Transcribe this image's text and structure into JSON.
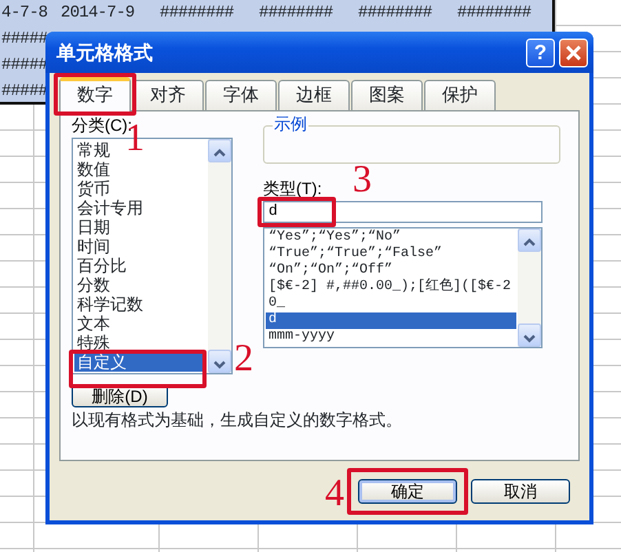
{
  "sheet": {
    "rows": [
      {
        "selected": true,
        "cells": [
          "4-7-8",
          "2014-7-9",
          "########",
          "########",
          "########",
          "########"
        ]
      },
      {
        "selected": true,
        "cells": [
          "#####"
        ]
      },
      {
        "selected": true,
        "cells": [
          "#####"
        ]
      },
      {
        "selected": true,
        "cells": [
          "#####"
        ]
      }
    ]
  },
  "dialog": {
    "title": "单元格格式",
    "help": "?",
    "tabs": [
      {
        "label": "数字",
        "selected": true,
        "annotation": "1"
      },
      {
        "label": "对齐",
        "selected": false
      },
      {
        "label": "字体",
        "selected": false
      },
      {
        "label": "边框",
        "selected": false
      },
      {
        "label": "图案",
        "selected": false
      },
      {
        "label": "保护",
        "selected": false
      }
    ],
    "category_label": "分类(C):",
    "categories": [
      {
        "label": "常规",
        "selected": false
      },
      {
        "label": "数值",
        "selected": false
      },
      {
        "label": "货币",
        "selected": false
      },
      {
        "label": "会计专用",
        "selected": false
      },
      {
        "label": "日期",
        "selected": false
      },
      {
        "label": "时间",
        "selected": false
      },
      {
        "label": "百分比",
        "selected": false
      },
      {
        "label": "分数",
        "selected": false
      },
      {
        "label": "科学记数",
        "selected": false
      },
      {
        "label": "文本",
        "selected": false
      },
      {
        "label": "特殊",
        "selected": false
      },
      {
        "label": "自定义",
        "selected": true,
        "annotation": "2"
      }
    ],
    "delete_button": "删除(D)",
    "sample_label": "示例",
    "type_label": "类型(T):",
    "type_input": {
      "value": "d",
      "annotation": "3"
    },
    "types": [
      {
        "label": "“Yes”;“Yes”;“No”",
        "selected": false
      },
      {
        "label": "“True”;“True”;“False”",
        "selected": false
      },
      {
        "label": "“On”;“On”;“Off”",
        "selected": false
      },
      {
        "label": "[$€-2] #,##0.00_);[红色]([$€-2",
        "selected": false
      },
      {
        "label": "0_",
        "selected": false
      },
      {
        "label": "d",
        "selected": true
      },
      {
        "label": "mmm-yyyy",
        "selected": false
      }
    ],
    "description": "以现有格式为基础，生成自定义的数字格式。",
    "buttons": [
      {
        "label": "确定",
        "default": true,
        "annotation": "4"
      },
      {
        "label": "取消",
        "default": false
      }
    ]
  }
}
